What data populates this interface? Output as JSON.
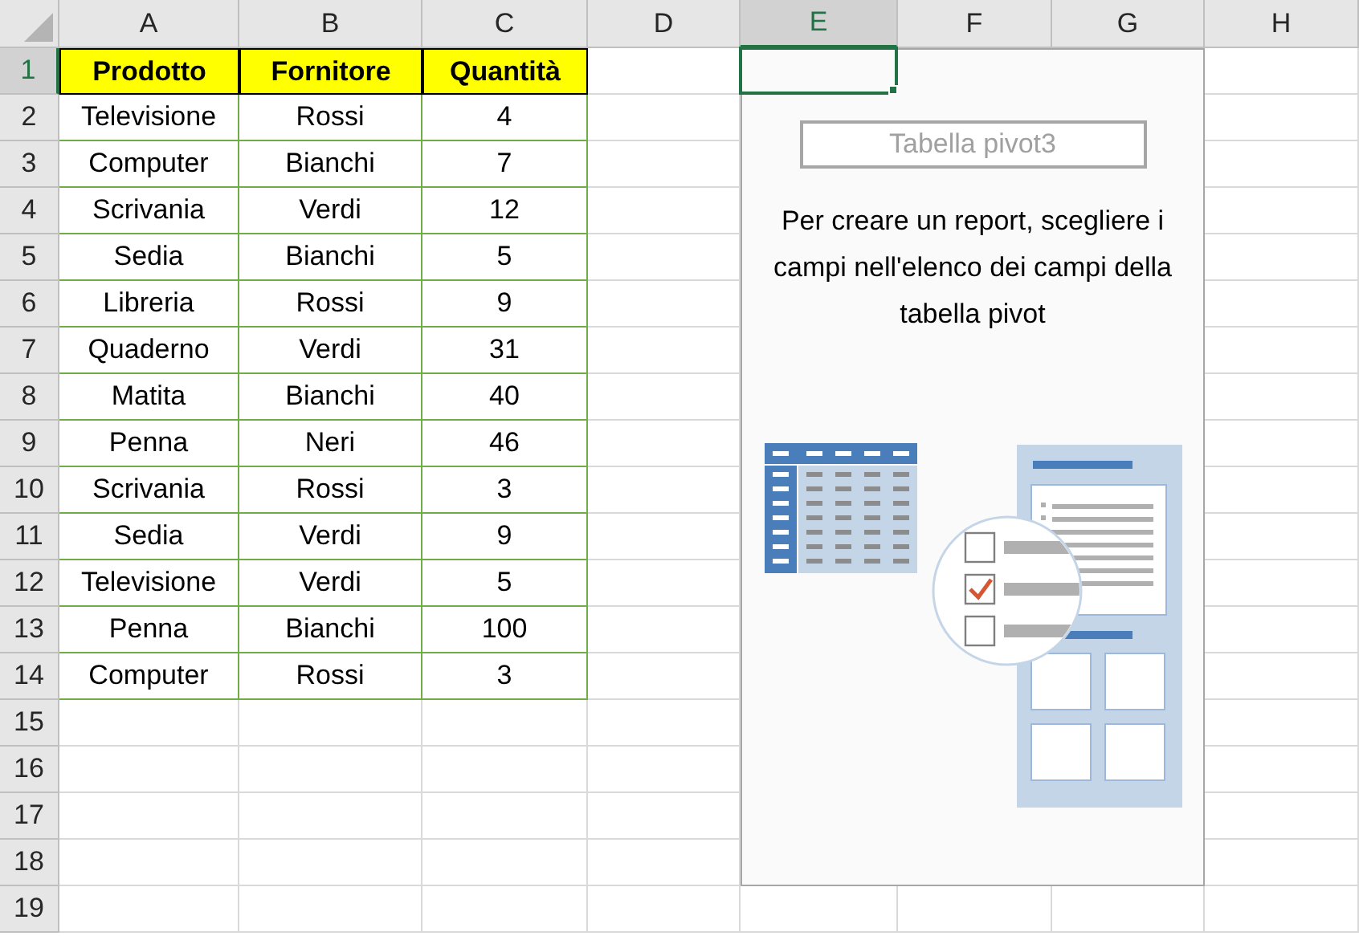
{
  "column_headers": [
    {
      "label": "A",
      "selected": false
    },
    {
      "label": "B",
      "selected": false
    },
    {
      "label": "C",
      "selected": false
    },
    {
      "label": "D",
      "selected": false
    },
    {
      "label": "E",
      "selected": true
    },
    {
      "label": "F",
      "selected": false
    },
    {
      "label": "G",
      "selected": false
    },
    {
      "label": "H",
      "selected": false
    }
  ],
  "rows": [
    {
      "number": "1",
      "selected": true,
      "kind": "header",
      "cells": [
        "Prodotto",
        "Fornitore",
        "Quantità"
      ]
    },
    {
      "number": "2",
      "selected": false,
      "kind": "data",
      "cells": [
        "Televisione",
        "Rossi",
        "4"
      ]
    },
    {
      "number": "3",
      "selected": false,
      "kind": "data",
      "cells": [
        "Computer",
        "Bianchi",
        "7"
      ]
    },
    {
      "number": "4",
      "selected": false,
      "kind": "data",
      "cells": [
        "Scrivania",
        "Verdi",
        "12"
      ]
    },
    {
      "number": "5",
      "selected": false,
      "kind": "data",
      "cells": [
        "Sedia",
        "Bianchi",
        "5"
      ]
    },
    {
      "number": "6",
      "selected": false,
      "kind": "data",
      "cells": [
        "Libreria",
        "Rossi",
        "9"
      ]
    },
    {
      "number": "7",
      "selected": false,
      "kind": "data",
      "cells": [
        "Quaderno",
        "Verdi",
        "31"
      ]
    },
    {
      "number": "8",
      "selected": false,
      "kind": "data",
      "cells": [
        "Matita",
        "Bianchi",
        "40"
      ]
    },
    {
      "number": "9",
      "selected": false,
      "kind": "data",
      "cells": [
        "Penna",
        "Neri",
        "46"
      ]
    },
    {
      "number": "10",
      "selected": false,
      "kind": "data",
      "cells": [
        "Scrivania",
        "Rossi",
        "3"
      ]
    },
    {
      "number": "11",
      "selected": false,
      "kind": "data",
      "cells": [
        "Sedia",
        "Verdi",
        "9"
      ]
    },
    {
      "number": "12",
      "selected": false,
      "kind": "data",
      "cells": [
        "Televisione",
        "Verdi",
        "5"
      ]
    },
    {
      "number": "13",
      "selected": false,
      "kind": "data",
      "cells": [
        "Penna",
        "Bianchi",
        "100"
      ]
    },
    {
      "number": "14",
      "selected": false,
      "kind": "data",
      "cells": [
        "Computer",
        "Rossi",
        "3"
      ]
    },
    {
      "number": "15",
      "selected": false,
      "kind": "empty"
    },
    {
      "number": "16",
      "selected": false,
      "kind": "empty"
    },
    {
      "number": "17",
      "selected": false,
      "kind": "empty"
    },
    {
      "number": "18",
      "selected": false,
      "kind": "empty"
    },
    {
      "number": "19",
      "selected": false,
      "kind": "empty"
    }
  ],
  "pivot_placeholder": {
    "title": "Tabella pivot3",
    "message": "Per creare un report, scegliere i campi nell'elenco dei campi della tabella pivot"
  }
}
